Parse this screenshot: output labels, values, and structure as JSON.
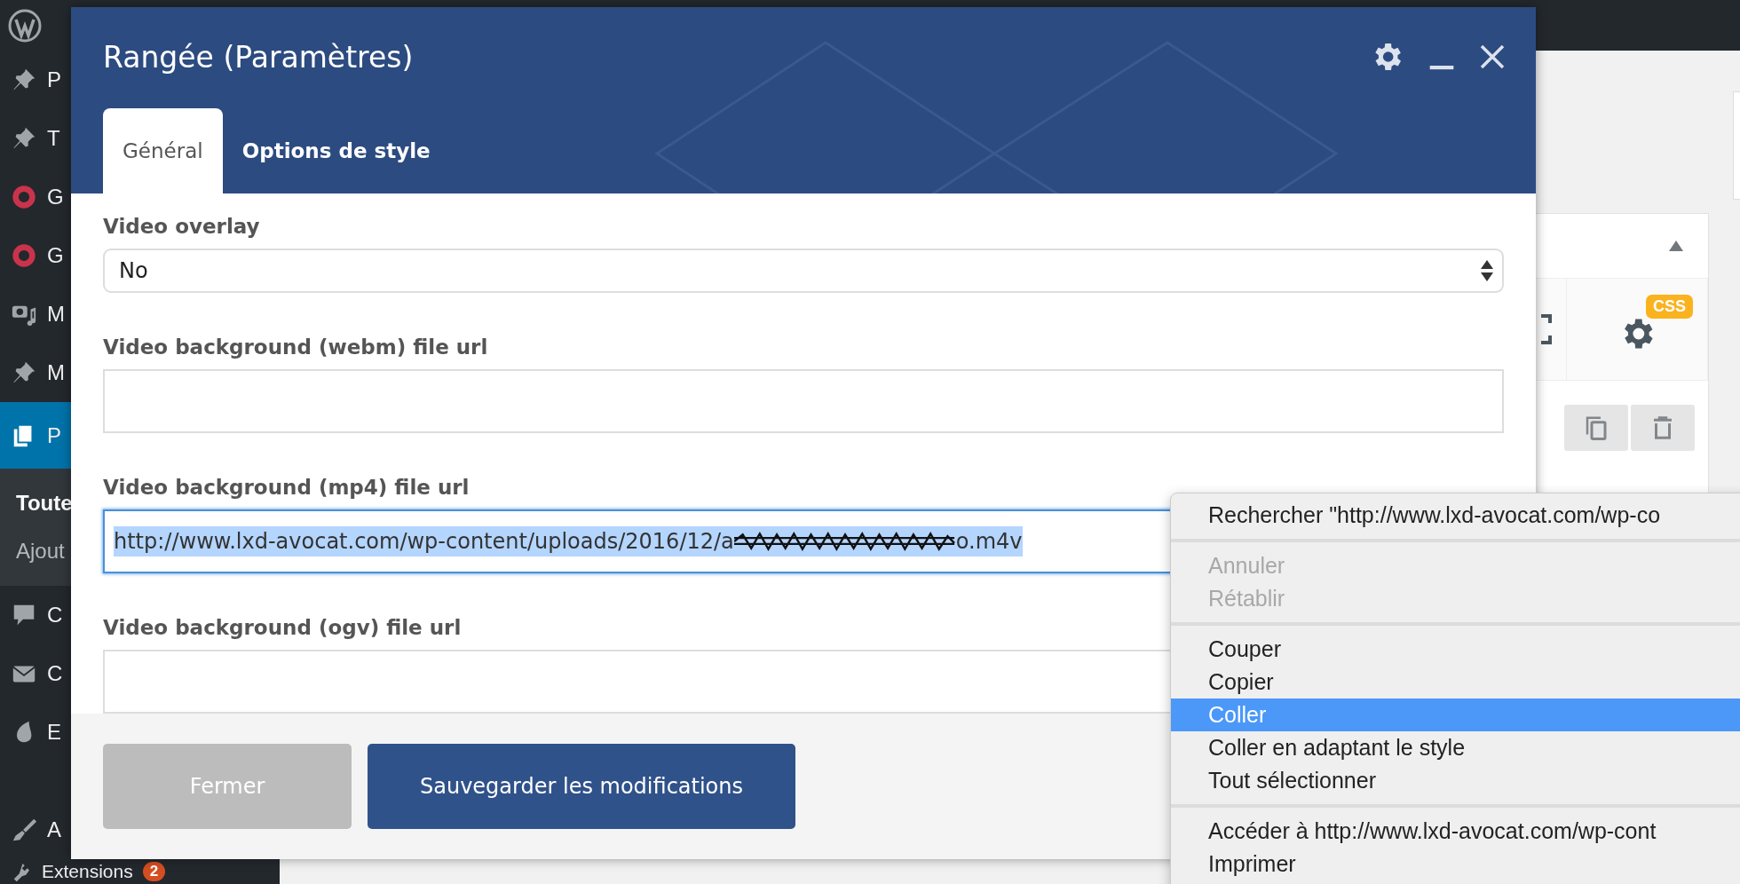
{
  "sidebar": {
    "items": [
      {
        "label": "P",
        "kind": "pin",
        "selected": false
      },
      {
        "label": "T",
        "kind": "pin",
        "selected": false
      },
      {
        "label": "G",
        "kind": "ring",
        "selected": false
      },
      {
        "label": "G",
        "kind": "ring",
        "selected": false
      },
      {
        "label": "M",
        "kind": "media",
        "selected": false
      },
      {
        "label": "M",
        "kind": "pin",
        "selected": false
      },
      {
        "label": "P",
        "kind": "pages",
        "selected": true,
        "submenu": [
          {
            "label": "Toute",
            "selected": true
          },
          {
            "label": "Ajout",
            "selected": false
          }
        ]
      },
      {
        "label": "C",
        "kind": "comment",
        "selected": false
      },
      {
        "label": "C",
        "kind": "mail",
        "selected": false
      },
      {
        "label": "E",
        "kind": "drop",
        "selected": false
      },
      {
        "label": "A",
        "kind": "brush",
        "selected": false
      },
      {
        "label": "Extensions",
        "kind": "plug",
        "selected": false,
        "badge": "2"
      }
    ]
  },
  "builder": {
    "badge": "CSS"
  },
  "modal": {
    "title": "Rangée (Paramètres)",
    "tabs": [
      {
        "label": "Général",
        "selected": true
      },
      {
        "label": "Options de style",
        "selected": false
      }
    ],
    "fields": [
      {
        "kind": "select",
        "label": "Video overlay",
        "value": "No"
      },
      {
        "kind": "text",
        "label": "Video background (webm) file url",
        "focused": false
      },
      {
        "kind": "text",
        "label": "Video background (mp4) file url",
        "focused": true,
        "value_start": "http://www.lxd-avocat.com/wp-content/uploads/2016/12/a",
        "redacted": true,
        "value_end": "o.m4v"
      },
      {
        "kind": "text",
        "label": "Video background (ogv) file url",
        "focused": false
      }
    ],
    "buttons": [
      {
        "label": "Fermer",
        "kind": "secondary"
      },
      {
        "label": "Sauvegarder les modifications",
        "kind": "primary"
      }
    ]
  },
  "context_menu": {
    "groups": [
      {
        "items": [
          {
            "label": "Rechercher \"http://www.lxd-avocat.com/wp-co",
            "disabled": false,
            "selected": false
          }
        ]
      },
      {
        "items": [
          {
            "label": "Annuler",
            "disabled": true,
            "selected": false
          },
          {
            "label": "Rétablir",
            "disabled": true,
            "selected": false
          }
        ]
      },
      {
        "items": [
          {
            "label": "Couper",
            "disabled": false,
            "selected": false
          },
          {
            "label": "Copier",
            "disabled": false,
            "selected": false
          },
          {
            "label": "Coller",
            "disabled": false,
            "selected": true
          },
          {
            "label": "Coller en adaptant le style",
            "disabled": false,
            "selected": false
          },
          {
            "label": "Tout sélectionner",
            "disabled": false,
            "selected": false
          }
        ]
      },
      {
        "items": [
          {
            "label": "Accéder à http://www.lxd-avocat.com/wp-cont",
            "disabled": false,
            "selected": false
          },
          {
            "label": "Imprimer",
            "disabled": false,
            "selected": false
          }
        ]
      }
    ]
  }
}
